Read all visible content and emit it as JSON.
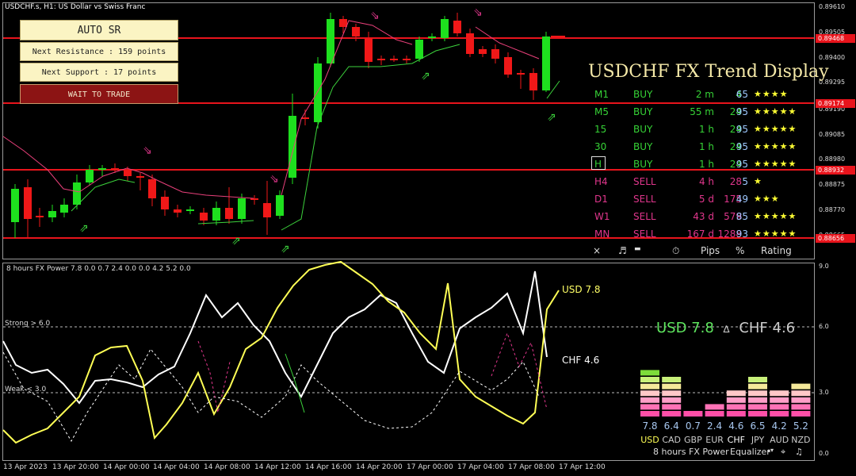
{
  "chart": {
    "title": "USDCHF.s, H1:  US Dollar vs Swiss Franc",
    "price_axis": [
      "0.89610",
      "0.89505",
      "0.89400",
      "0.89295",
      "0.89190",
      "0.89085",
      "0.88980",
      "0.88875",
      "0.88770",
      "0.88665"
    ],
    "price_boxes": [
      "0.89468",
      "0.89174",
      "0.88932",
      "0.88656"
    ],
    "time_axis": [
      "13 Apr 2023",
      "13 Apr 20:00",
      "14 Apr 00:00",
      "14 Apr 04:00",
      "14 Apr 08:00",
      "14 Apr 12:00",
      "14 Apr 16:00",
      "14 Apr 20:00",
      "17 Apr 00:00",
      "17 Apr 04:00",
      "17 Apr 08:00",
      "17 Apr 12:00"
    ]
  },
  "auto_sr": {
    "title": "AUTO SR",
    "resistance": "Next Resistance : 159 points",
    "support": "Next Support : 17 points",
    "status": "WAIT TO TRADE"
  },
  "trend": {
    "title": "USDCHF FX Trend Display",
    "rows": [
      {
        "tf": "M1",
        "dir": "BUY",
        "time": "2 m",
        "pips": "4",
        "pct": "65",
        "stars": "★★★★",
        "color": "#36d236"
      },
      {
        "tf": "M5",
        "dir": "BUY",
        "time": "55 m",
        "pips": "24",
        "pct": "95",
        "stars": "★★★★★",
        "color": "#36d236"
      },
      {
        "tf": "15",
        "dir": "BUY",
        "time": "1 h",
        "pips": "24",
        "pct": "95",
        "stars": "★★★★★",
        "color": "#36d236"
      },
      {
        "tf": "30",
        "dir": "BUY",
        "time": "1 h",
        "pips": "24",
        "pct": "95",
        "stars": "★★★★★",
        "color": "#36d236"
      },
      {
        "tf": "H",
        "dir": "BUY",
        "time": "1 h",
        "pips": "24",
        "pct": "95",
        "stars": "★★★★★",
        "color": "#36d236"
      },
      {
        "tf": "H4",
        "dir": "SELL",
        "time": "4 h",
        "pips": "28",
        "pct": "5",
        "stars": "★",
        "color": "#e0368c"
      },
      {
        "tf": "D1",
        "dir": "SELL",
        "time": "5 d",
        "pips": "175",
        "pct": "49",
        "stars": "★★★",
        "color": "#e0368c"
      },
      {
        "tf": "W1",
        "dir": "SELL",
        "time": "43 d",
        "pips": "579",
        "pct": "85",
        "stars": "★★★★★",
        "color": "#e0368c"
      },
      {
        "tf": "MN",
        "dir": "SELL",
        "time": "167 d",
        "pips": "1288",
        "pct": "93",
        "stars": "★★★★★",
        "color": "#e0368c"
      }
    ],
    "footer": {
      "close": "×",
      "pips": "Pips",
      "pct": "%",
      "rating": "Rating"
    }
  },
  "power": {
    "label": "8 hours FX Power 7.8 0.0 0.7 2.4 0.0 0.0 4.2 5.2 0.0",
    "strong": "Strong > 6.0",
    "weak": "Weak < 3.0",
    "usd_tag": "USD 7.8",
    "chf_tag": "CHF 4.6",
    "pair_usd": "USD 7.8",
    "pair_sep": "∆",
    "pair_chf": "CHF 4.6",
    "axis": [
      "9.0",
      "6.0",
      "3.0",
      "0.0"
    ],
    "currencies": [
      {
        "name": "USD",
        "value": "7.8",
        "level": 7.8
      },
      {
        "name": "CAD",
        "value": "6.4",
        "level": 6.4
      },
      {
        "name": "GBP",
        "value": "0.7",
        "level": 0.7
      },
      {
        "name": "EUR",
        "value": "2.4",
        "level": 2.4
      },
      {
        "name": "CHF",
        "value": "4.6",
        "level": 4.6
      },
      {
        "name": "JPY",
        "value": "6.5",
        "level": 6.5
      },
      {
        "name": "AUD",
        "value": "4.2",
        "level": 4.2
      },
      {
        "name": "NZD",
        "value": "5.2",
        "level": 5.2
      }
    ],
    "footer": {
      "hours": "8 hours",
      "title": "FX Power",
      "eq": "Equalizer"
    }
  }
}
